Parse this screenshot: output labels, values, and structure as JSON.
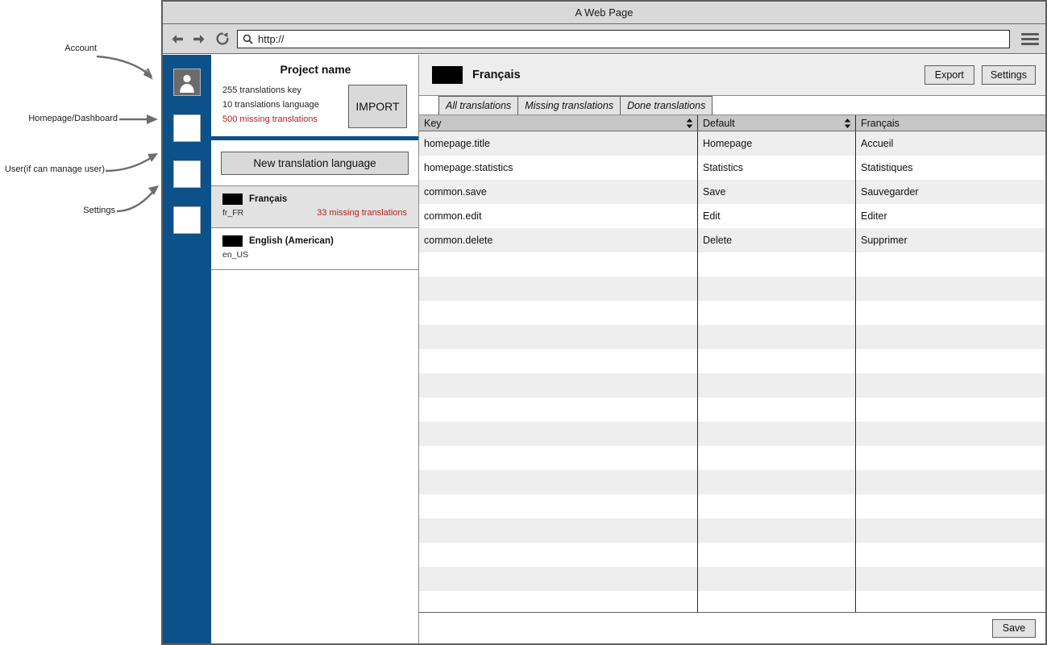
{
  "annotations": [
    {
      "label": "Account",
      "target": "avatar-rail-item"
    },
    {
      "label": "Homepage/Dashboard",
      "target": "dashboard-rail-item"
    },
    {
      "label": "User(if can manage user)",
      "target": "users-rail-item"
    },
    {
      "label": "Settings",
      "target": "settings-rail-item"
    }
  ],
  "browser": {
    "title": "A Web Page",
    "url": "http://",
    "back_icon": "back-arrow-icon",
    "forward_icon": "forward-arrow-icon",
    "reload_icon": "reload-icon",
    "search_icon": "search-icon",
    "menu_icon": "hamburger-menu-icon"
  },
  "rail": {
    "items": [
      {
        "name": "avatar-rail-item",
        "icon": "user-avatar-icon"
      },
      {
        "name": "dashboard-rail-item",
        "icon": "blank-square-icon"
      },
      {
        "name": "users-rail-item",
        "icon": "blank-square-icon"
      },
      {
        "name": "settings-rail-item",
        "icon": "blank-square-icon"
      }
    ]
  },
  "project": {
    "title": "Project name",
    "stats": [
      {
        "text": "255 translations key",
        "warn": false
      },
      {
        "text": "10 translations language",
        "warn": false
      },
      {
        "text": "500 missing translations",
        "warn": true
      }
    ],
    "import_label": "IMPORT",
    "new_language_label": "New translation language"
  },
  "languages": [
    {
      "name": "Français",
      "code": "fr_FR",
      "missing": "33 missing translations",
      "selected": true,
      "flag": "flag-icon"
    },
    {
      "name": "English (American)",
      "code": "en_US",
      "missing": "",
      "selected": false,
      "flag": "flag-icon"
    }
  ],
  "main": {
    "language": "Français",
    "flag": "flag-icon",
    "export_label": "Export",
    "settings_label": "Settings",
    "tabs": [
      {
        "label": "All translations",
        "active": true
      },
      {
        "label": "Missing translations",
        "active": false
      },
      {
        "label": "Done translations",
        "active": false
      }
    ],
    "columns": [
      {
        "label": "Key",
        "sortable": true
      },
      {
        "label": "Default",
        "sortable": true
      },
      {
        "label": "Français",
        "sortable": false
      }
    ],
    "rows": [
      {
        "key": "homepage.title",
        "default": "Homepage",
        "target": "Accueil"
      },
      {
        "key": "homepage.statistics",
        "default": "Statistics",
        "target": "Statistiques"
      },
      {
        "key": "common.save",
        "default": "Save",
        "target": "Sauvegarder"
      },
      {
        "key": "common.edit",
        "default": "Edit",
        "target": "Editer"
      },
      {
        "key": "common.delete",
        "default": "Delete",
        "target": "Supprimer"
      },
      {
        "key": "",
        "default": "",
        "target": ""
      },
      {
        "key": "",
        "default": "",
        "target": ""
      },
      {
        "key": "",
        "default": "",
        "target": ""
      },
      {
        "key": "",
        "default": "",
        "target": ""
      },
      {
        "key": "",
        "default": "",
        "target": ""
      },
      {
        "key": "",
        "default": "",
        "target": ""
      },
      {
        "key": "",
        "default": "",
        "target": ""
      },
      {
        "key": "",
        "default": "",
        "target": ""
      },
      {
        "key": "",
        "default": "",
        "target": ""
      },
      {
        "key": "",
        "default": "",
        "target": ""
      },
      {
        "key": "",
        "default": "",
        "target": ""
      },
      {
        "key": "",
        "default": "",
        "target": ""
      },
      {
        "key": "",
        "default": "",
        "target": ""
      },
      {
        "key": "",
        "default": "",
        "target": ""
      },
      {
        "key": "",
        "default": "",
        "target": ""
      }
    ],
    "save_label": "Save"
  },
  "colors": {
    "rail_blue": "#0c5189",
    "warn_red": "#b22222",
    "chrome_gray": "#d9d9d9",
    "row_alt": "#eeeeee",
    "header_gray": "#c6c6c6"
  }
}
